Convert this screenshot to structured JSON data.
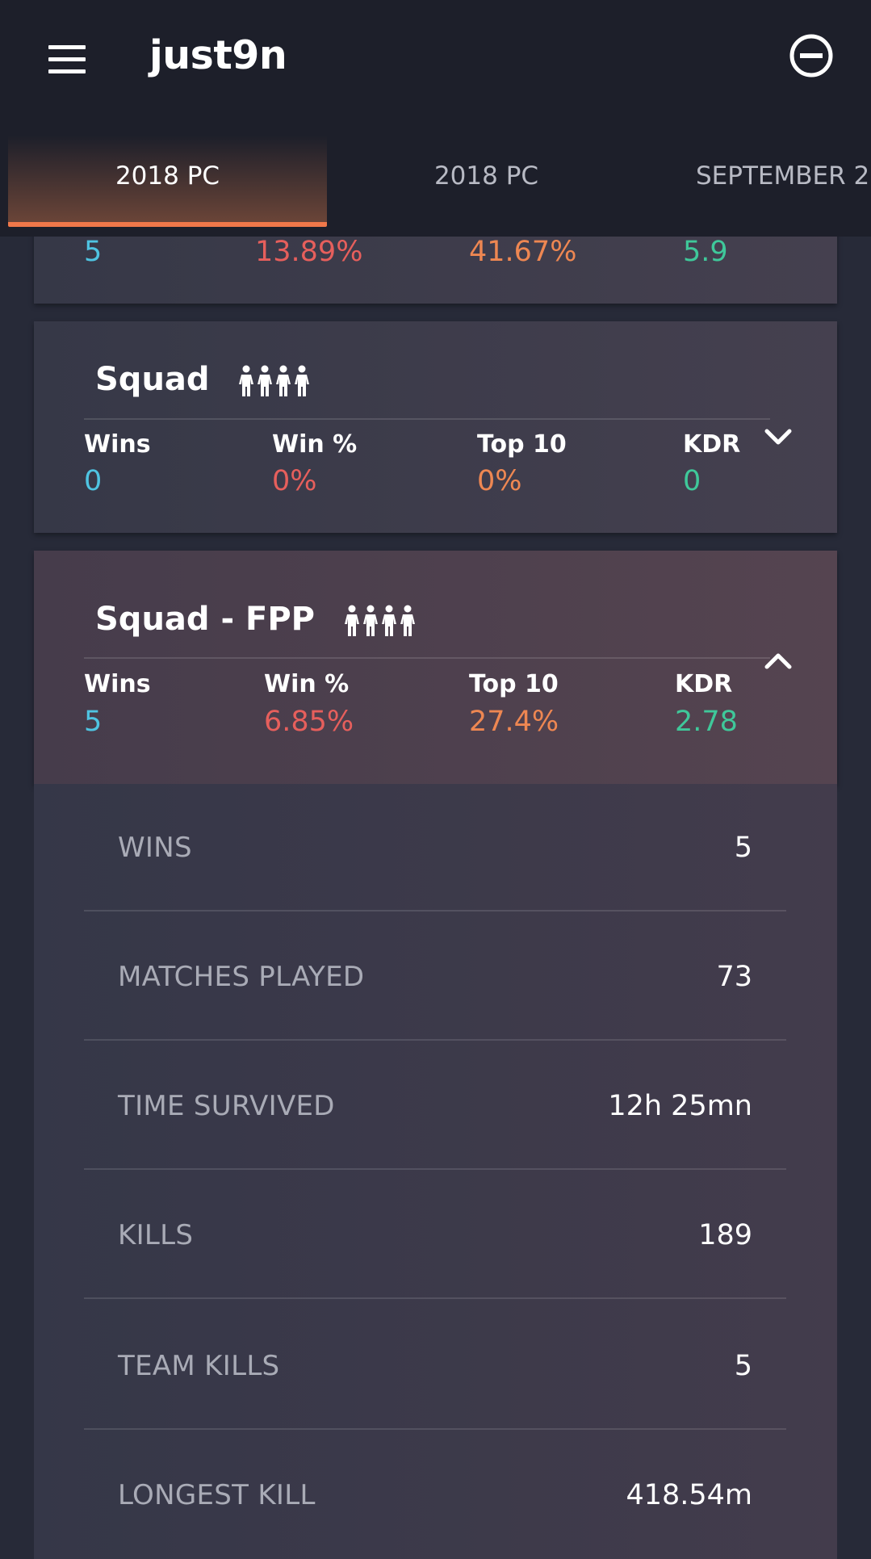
{
  "header": {
    "title": "just9n",
    "menu_icon": "hamburger-menu-icon",
    "logout_icon": "minus-circle-icon"
  },
  "tabs": [
    {
      "label": "2018 PC",
      "active": true
    },
    {
      "label": "2018 PC",
      "active": false
    },
    {
      "label": "SEPTEMBER 2",
      "active": false
    }
  ],
  "partial_card": {
    "wins": "5",
    "win_pct": "13.89%",
    "top10": "41.67%",
    "kdr": "5.9"
  },
  "squad_card": {
    "title": "Squad",
    "icon": "squad-people-icon",
    "labels": {
      "wins": "Wins",
      "win_pct": "Win %",
      "top10": "Top 10",
      "kdr": "KDR"
    },
    "values": {
      "wins": "0",
      "win_pct": "0%",
      "top10": "0%",
      "kdr": "0"
    },
    "expanded": false
  },
  "squad_fpp_card": {
    "title": "Squad - FPP",
    "icon": "squad-people-icon",
    "labels": {
      "wins": "Wins",
      "win_pct": "Win %",
      "top10": "Top 10",
      "kdr": "KDR"
    },
    "values": {
      "wins": "5",
      "win_pct": "6.85%",
      "top10": "27.4%",
      "kdr": "2.78"
    },
    "expanded": true
  },
  "details": [
    {
      "label": "WINS",
      "value": "5"
    },
    {
      "label": "MATCHES PLAYED",
      "value": "73"
    },
    {
      "label": "TIME SURVIVED",
      "value": "12h 25mn"
    },
    {
      "label": "KILLS",
      "value": "189"
    },
    {
      "label": "TEAM KILLS",
      "value": "5"
    },
    {
      "label": "LONGEST KILL",
      "value": "418.54m"
    }
  ],
  "colors": {
    "wins": "#4fc4e2",
    "win_pct": "#e65f5c",
    "top10": "#ee8752",
    "kdr": "#3fc89a",
    "accent": "#f0784a"
  }
}
